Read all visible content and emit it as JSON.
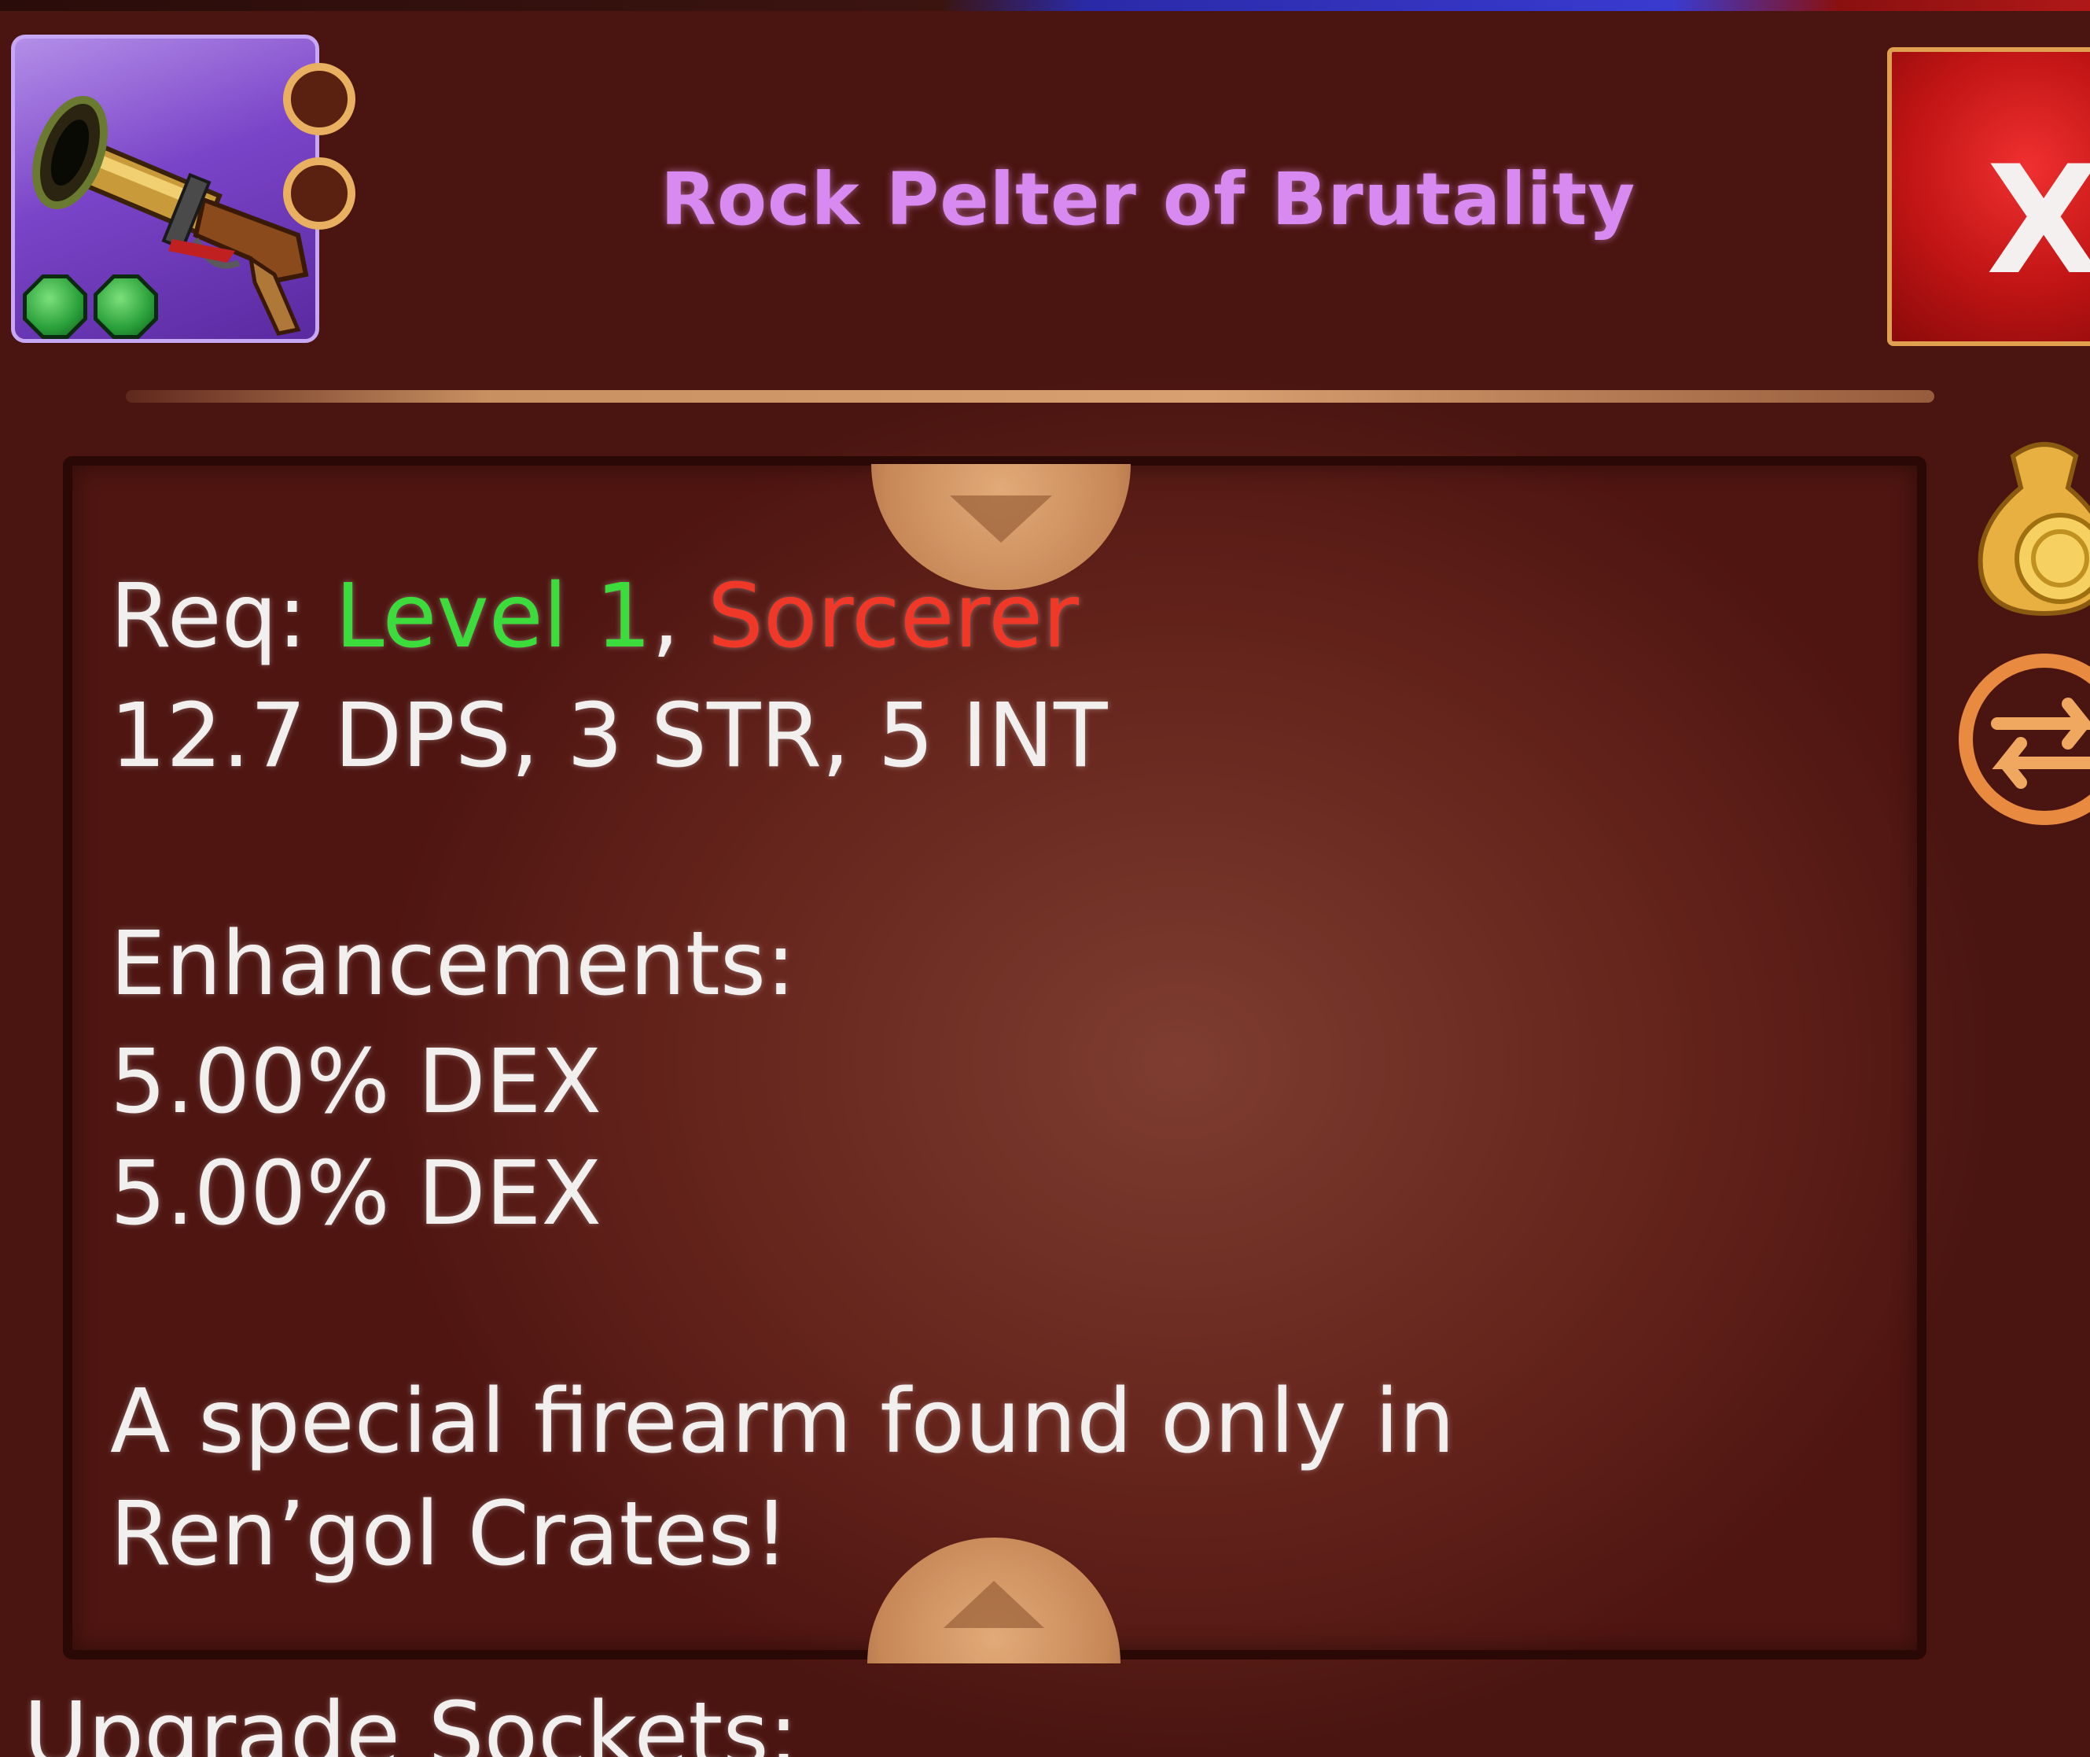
{
  "item": {
    "name": "Rock Pelter of Brutality",
    "icon": "blunderbuss-icon",
    "rarity_color": "#d98af0",
    "upgrade_slots": [
      "empty-slot",
      "empty-slot"
    ],
    "gems": [
      "green-gem",
      "green-gem"
    ]
  },
  "close": {
    "label": "X"
  },
  "requirements": {
    "prefix": "Req: ",
    "level": "Level 1",
    "separator": ", ",
    "class": "Sorcerer",
    "level_color": "#3cdc3c",
    "class_color": "#f03828"
  },
  "stats": "12.7 DPS, 3 STR, 5 INT",
  "enhancements": {
    "heading": "Enhancements:",
    "lines": [
      "5.00% DEX",
      "5.00% DEX"
    ]
  },
  "description": {
    "line1": "A special firearm found only in",
    "line2": "Ren’gol Crates!"
  },
  "sockets": {
    "heading": "Upgrade Sockets:"
  },
  "side_actions": {
    "sell": "coin-bag-icon",
    "swap": "swap-arrows-icon"
  }
}
